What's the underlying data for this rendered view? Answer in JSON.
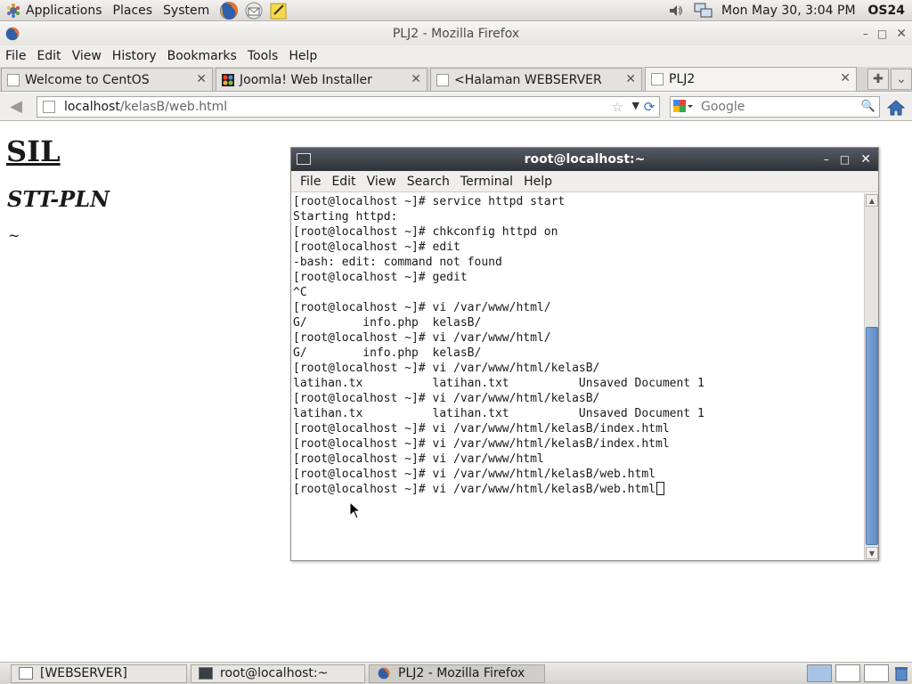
{
  "top_panel": {
    "menus": [
      "Applications",
      "Places",
      "System"
    ],
    "launchers": [
      "firefox-icon",
      "mail-icon",
      "notes-icon"
    ],
    "clock": "Mon May 30,  3:04 PM",
    "user": "OS24"
  },
  "firefox": {
    "title": "PLJ2 - Mozilla Firefox",
    "menu": [
      "File",
      "Edit",
      "View",
      "History",
      "Bookmarks",
      "Tools",
      "Help"
    ],
    "tabs": [
      {
        "label": "Welcome to CentOS",
        "icon": "blank-page-icon",
        "active": false
      },
      {
        "label": "Joomla! Web Installer",
        "icon": "joomla-icon",
        "active": false
      },
      {
        "label": "<Halaman WEBSERVER",
        "icon": "blank-page-icon",
        "active": false
      },
      {
        "label": "PLJ2",
        "icon": "blank-page-icon",
        "active": true
      }
    ],
    "url_host": "localhost",
    "url_path": "/kelasB/web.html",
    "search_placeholder": "Google"
  },
  "page": {
    "heading1": "SIL",
    "heading2": "STT-PLN",
    "tilde": "~"
  },
  "terminal": {
    "title": "root@localhost:~",
    "menu": [
      "File",
      "Edit",
      "View",
      "Search",
      "Terminal",
      "Help"
    ],
    "lines": [
      "[root@localhost ~]# service httpd start",
      "Starting httpd:",
      "[root@localhost ~]# chkconfig httpd on",
      "[root@localhost ~]# edit",
      "-bash: edit: command not found",
      "[root@localhost ~]# gedit",
      "^C",
      "[root@localhost ~]# vi /var/www/html/",
      "G/        info.php  kelasB/",
      "[root@localhost ~]# vi /var/www/html/",
      "G/        info.php  kelasB/",
      "[root@localhost ~]# vi /var/www/html/kelasB/",
      "latihan.tx          latihan.txt          Unsaved Document 1",
      "[root@localhost ~]# vi /var/www/html/kelasB/",
      "latihan.tx          latihan.txt          Unsaved Document 1",
      "[root@localhost ~]# vi /var/www/html/kelasB/index.html",
      "[root@localhost ~]# vi /var/www/html/kelasB/index.html",
      "[root@localhost ~]# vi /var/www/html",
      "[root@localhost ~]# vi /var/www/html/kelasB/web.html"
    ],
    "current_line": "[root@localhost ~]# vi /var/www/html/kelasB/web.html"
  },
  "taskbar": {
    "items": [
      {
        "label": "[WEBSERVER]",
        "icon": "window-icon",
        "active": false
      },
      {
        "label": "root@localhost:~",
        "icon": "terminal-icon",
        "active": false
      },
      {
        "label": "PLJ2 - Mozilla Firefox",
        "icon": "firefox-icon",
        "active": true
      }
    ]
  },
  "colors": {
    "terminal_titlebar": "#2e3238",
    "scrollbar_thumb": "#5f8cc7",
    "panel_bg": "#dcdad5"
  }
}
